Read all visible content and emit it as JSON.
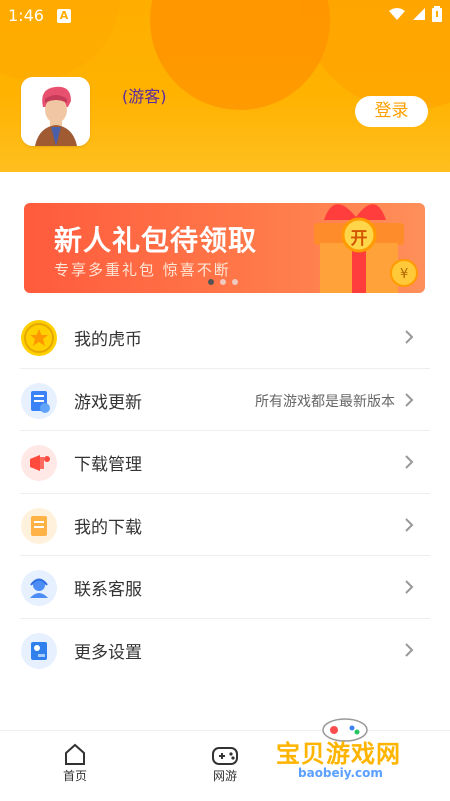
{
  "status": {
    "time": "1:46",
    "notification_letter": "A"
  },
  "profile": {
    "name": "(游客)",
    "login_label": "登录"
  },
  "banner": {
    "title": "新人礼包待领取",
    "subtitle": "专享多重礼包 惊喜不断",
    "badge": "开",
    "dots_total": 3,
    "active_index": 0
  },
  "menu": [
    {
      "label": "我的虎币",
      "note": "",
      "icon": "coin-icon",
      "color": "#ffd000"
    },
    {
      "label": "游戏更新",
      "note": "所有游戏都是最新版本",
      "icon": "update-icon",
      "color": "#3b82f6"
    },
    {
      "label": "下载管理",
      "note": "",
      "icon": "download-manage-icon",
      "color": "#ff4a3d"
    },
    {
      "label": "我的下载",
      "note": "",
      "icon": "my-download-icon",
      "color": "#ffb347"
    },
    {
      "label": "联系客服",
      "note": "",
      "icon": "customer-service-icon",
      "color": "#4c8df6"
    },
    {
      "label": "更多设置",
      "note": "",
      "icon": "settings-icon",
      "color": "#2f80ed"
    }
  ],
  "nav": {
    "home": "首页",
    "online_games": "网游"
  },
  "watermark": {
    "name": "宝贝游戏网",
    "domain": "baobeiy.com"
  }
}
